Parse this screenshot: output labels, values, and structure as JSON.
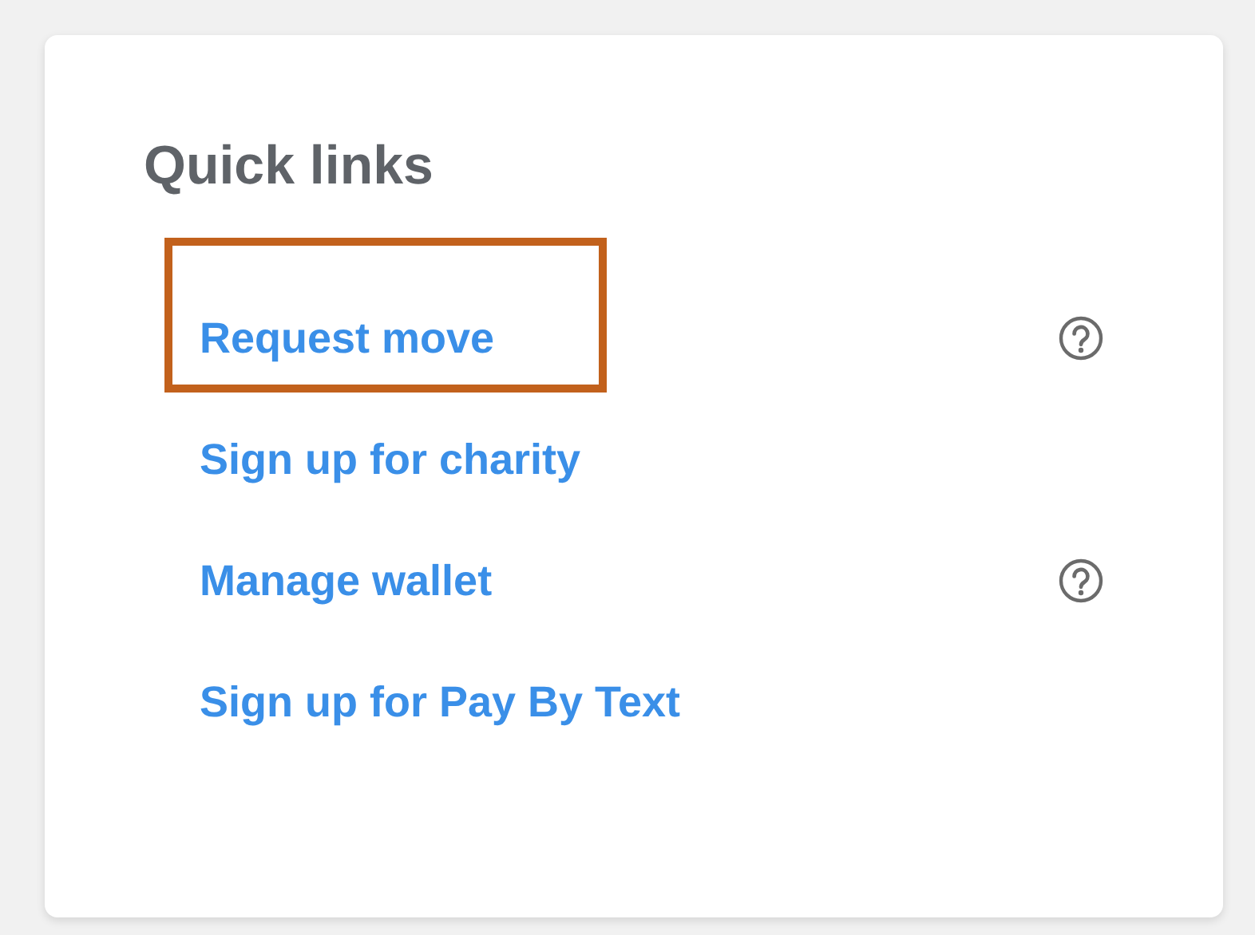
{
  "card": {
    "title": "Quick links",
    "links": [
      {
        "label": "Request move",
        "help": true,
        "highlighted": true
      },
      {
        "label": "Sign up for charity",
        "help": false,
        "highlighted": false
      },
      {
        "label": "Manage wallet",
        "help": true,
        "highlighted": false
      },
      {
        "label": "Sign up for Pay By Text",
        "help": false,
        "highlighted": false
      }
    ]
  }
}
